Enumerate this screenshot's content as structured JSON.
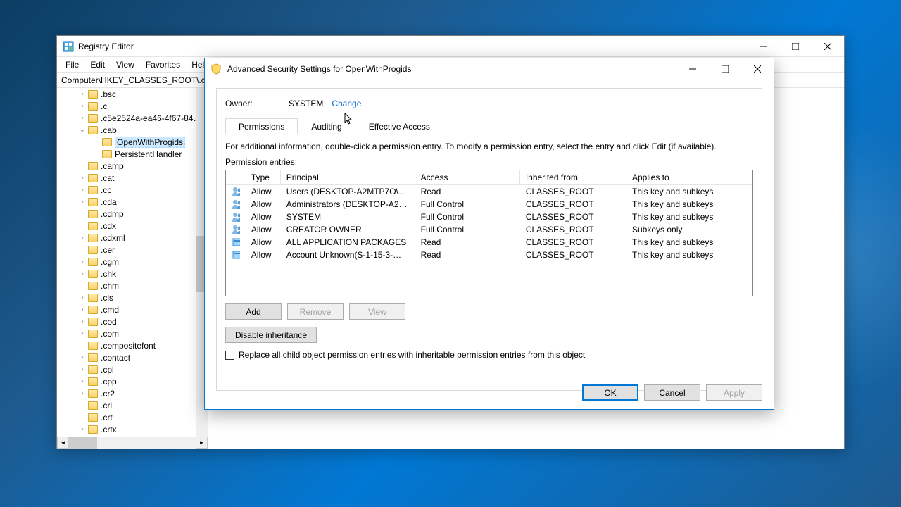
{
  "main_window": {
    "title": "Registry Editor",
    "menu": [
      "File",
      "Edit",
      "View",
      "Favorites",
      "Help"
    ],
    "path": "Computer\\HKEY_CLASSES_ROOT\\.cab\\OpenWithProgids"
  },
  "tree": [
    {
      "label": ".bsc",
      "expander": ">",
      "indent": 1
    },
    {
      "label": ".c",
      "expander": ">",
      "indent": 1
    },
    {
      "label": ".c5e2524a-ea46-4f67-84…",
      "expander": ">",
      "indent": 1
    },
    {
      "label": ".cab",
      "expander": "v",
      "indent": 1
    },
    {
      "label": "OpenWithProgids",
      "expander": "",
      "indent": 2,
      "selected": true
    },
    {
      "label": "PersistentHandler",
      "expander": "",
      "indent": 2
    },
    {
      "label": ".camp",
      "expander": "",
      "indent": 1
    },
    {
      "label": ".cat",
      "expander": ">",
      "indent": 1
    },
    {
      "label": ".cc",
      "expander": ">",
      "indent": 1
    },
    {
      "label": ".cda",
      "expander": ">",
      "indent": 1
    },
    {
      "label": ".cdmp",
      "expander": "",
      "indent": 1
    },
    {
      "label": ".cdx",
      "expander": "",
      "indent": 1
    },
    {
      "label": ".cdxml",
      "expander": ">",
      "indent": 1
    },
    {
      "label": ".cer",
      "expander": "",
      "indent": 1
    },
    {
      "label": ".cgm",
      "expander": ">",
      "indent": 1
    },
    {
      "label": ".chk",
      "expander": ">",
      "indent": 1
    },
    {
      "label": ".chm",
      "expander": "",
      "indent": 1
    },
    {
      "label": ".cls",
      "expander": ">",
      "indent": 1
    },
    {
      "label": ".cmd",
      "expander": ">",
      "indent": 1
    },
    {
      "label": ".cod",
      "expander": ">",
      "indent": 1
    },
    {
      "label": ".com",
      "expander": ">",
      "indent": 1
    },
    {
      "label": ".compositefont",
      "expander": "",
      "indent": 1
    },
    {
      "label": ".contact",
      "expander": ">",
      "indent": 1
    },
    {
      "label": ".cpl",
      "expander": ">",
      "indent": 1
    },
    {
      "label": ".cpp",
      "expander": ">",
      "indent": 1
    },
    {
      "label": ".cr2",
      "expander": ">",
      "indent": 1
    },
    {
      "label": ".crl",
      "expander": "",
      "indent": 1
    },
    {
      "label": ".crt",
      "expander": "",
      "indent": 1
    },
    {
      "label": ".crtx",
      "expander": ">",
      "indent": 1
    }
  ],
  "dialog": {
    "title": "Advanced Security Settings for OpenWithProgids",
    "owner_label": "Owner:",
    "owner_value": "SYSTEM",
    "change_link": "Change",
    "tabs": [
      "Permissions",
      "Auditing",
      "Effective Access"
    ],
    "info": "For additional information, double-click a permission entry. To modify a permission entry, select the entry and click Edit (if available).",
    "entries_label": "Permission entries:",
    "columns": [
      "",
      "Type",
      "Principal",
      "Access",
      "Inherited from",
      "Applies to"
    ],
    "rows": [
      {
        "icon": "user",
        "type": "Allow",
        "principal": "Users (DESKTOP-A2MTP7O\\U…",
        "access": "Read",
        "inherited": "CLASSES_ROOT",
        "applies": "This key and subkeys"
      },
      {
        "icon": "user",
        "type": "Allow",
        "principal": "Administrators (DESKTOP-A2…",
        "access": "Full Control",
        "inherited": "CLASSES_ROOT",
        "applies": "This key and subkeys"
      },
      {
        "icon": "user",
        "type": "Allow",
        "principal": "SYSTEM",
        "access": "Full Control",
        "inherited": "CLASSES_ROOT",
        "applies": "This key and subkeys"
      },
      {
        "icon": "user",
        "type": "Allow",
        "principal": "CREATOR OWNER",
        "access": "Full Control",
        "inherited": "CLASSES_ROOT",
        "applies": "Subkeys only"
      },
      {
        "icon": "pkg",
        "type": "Allow",
        "principal": "ALL APPLICATION PACKAGES",
        "access": "Read",
        "inherited": "CLASSES_ROOT",
        "applies": "This key and subkeys"
      },
      {
        "icon": "pkg",
        "type": "Allow",
        "principal": "Account Unknown(S-1-15-3-…",
        "access": "Read",
        "inherited": "CLASSES_ROOT",
        "applies": "This key and subkeys"
      }
    ],
    "buttons": {
      "add": "Add",
      "remove": "Remove",
      "view": "View",
      "disable": "Disable inheritance"
    },
    "replace_label": "Replace all child object permission entries with inheritable permission entries from this object",
    "footer": {
      "ok": "OK",
      "cancel": "Cancel",
      "apply": "Apply"
    }
  }
}
